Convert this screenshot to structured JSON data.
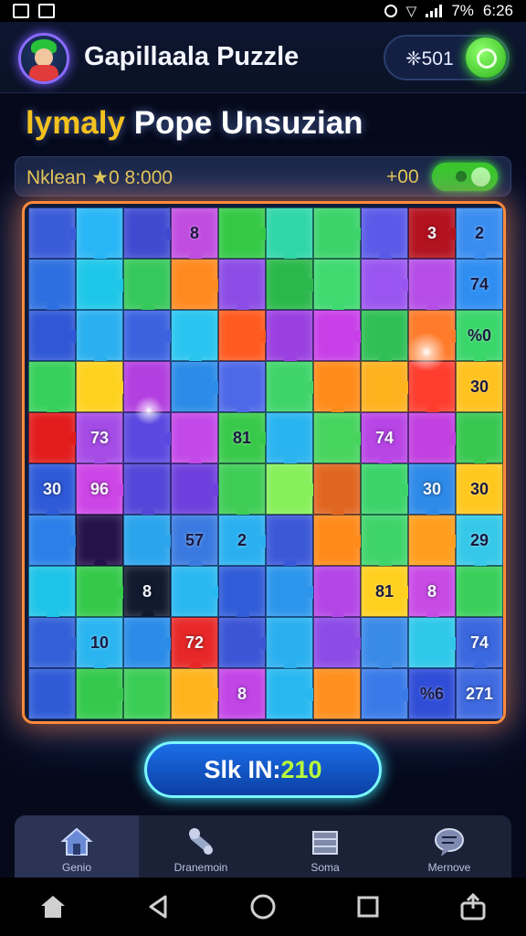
{
  "status_bar": {
    "battery": "7%",
    "time": "6:26"
  },
  "header": {
    "title": "Gapillaala Puzzle",
    "coins": "❈501"
  },
  "subtitle": {
    "part_a": "lymaly",
    "part_b": " Pope Unsuzian"
  },
  "info_bar": {
    "label": "Nklean ★0 8:000",
    "score": "+00"
  },
  "board": {
    "rows": [
      [
        {
          "c": "#3a5bd8"
        },
        {
          "c": "#29b6f6"
        },
        {
          "c": "#3f4ad0"
        },
        {
          "c": "#c04de0",
          "t": "8"
        },
        {
          "c": "#34c945"
        },
        {
          "c": "#2fd6a8"
        },
        {
          "c": "#3bd36a"
        },
        {
          "c": "#5a5ae8"
        },
        {
          "c": "#b3121f",
          "t": "3",
          "l": true
        },
        {
          "c": "#3a8df0",
          "t": "2"
        }
      ],
      [
        {
          "c": "#2d6fe0"
        },
        {
          "c": "#1ec7e8"
        },
        {
          "c": "#35c85a"
        },
        {
          "c": "#ff8a1f"
        },
        {
          "c": "#8c4ce6"
        },
        {
          "c": "#2ab84a"
        },
        {
          "c": "#3ed96f"
        },
        {
          "c": "#9a55f0"
        },
        {
          "c": "#b54de6"
        },
        {
          "c": "#2f8ef2",
          "t": "74"
        }
      ],
      [
        {
          "c": "#2f57d6"
        },
        {
          "c": "#2ab0f0"
        },
        {
          "c": "#3b63e0"
        },
        {
          "c": "#29c5f0"
        },
        {
          "c": "#ff5a1f"
        },
        {
          "c": "#9a3fe0"
        },
        {
          "c": "#c83fe8"
        },
        {
          "c": "#2fbf55"
        },
        {
          "c": "#ff7a2a"
        },
        {
          "c": "#39d66a",
          "t": "%0"
        }
      ],
      [
        {
          "c": "#36d05a"
        },
        {
          "c": "#ffd21e"
        },
        {
          "c": "#b23fe0"
        },
        {
          "c": "#2a8be8"
        },
        {
          "c": "#4d68e8"
        },
        {
          "c": "#3fd46a"
        },
        {
          "c": "#ff8c1a"
        },
        {
          "c": "#ffb11e"
        },
        {
          "c": "#ff3d2e"
        },
        {
          "c": "#ffc21e",
          "t": "30"
        }
      ],
      [
        {
          "c": "#e21b1b"
        },
        {
          "c": "#a64ce6",
          "t": "73",
          "l": true
        },
        {
          "c": "#5b48e0"
        },
        {
          "c": "#c348e8"
        },
        {
          "c": "#39c94a",
          "t": "81"
        },
        {
          "c": "#29b4f0"
        },
        {
          "c": "#47d45e"
        },
        {
          "c": "#b845e6",
          "t": "74",
          "l": true
        },
        {
          "c": "#c23fe0"
        },
        {
          "c": "#38c750"
        }
      ],
      [
        {
          "c": "#2e5ad8",
          "t": "30",
          "l": true
        },
        {
          "c": "#cc45e6",
          "t": "96",
          "l": true
        },
        {
          "c": "#5446d8"
        },
        {
          "c": "#6e3fdc"
        },
        {
          "c": "#3fcd55"
        },
        {
          "c": "#86f05a"
        },
        {
          "c": "#e0661f"
        },
        {
          "c": "#3bd36a"
        },
        {
          "c": "#2e8ae8",
          "t": "30",
          "l": true
        },
        {
          "c": "#ffc81e",
          "t": "30"
        }
      ],
      [
        {
          "c": "#2a80e8"
        },
        {
          "c": "#26124a"
        },
        {
          "c": "#2aa4ec"
        },
        {
          "c": "#3a7ae0",
          "t": "57"
        },
        {
          "c": "#2ab0f0",
          "t": "2"
        },
        {
          "c": "#3b58d8"
        },
        {
          "c": "#ff8a1a"
        },
        {
          "c": "#3fd46a"
        },
        {
          "c": "#ff9e1e"
        },
        {
          "c": "#35c8e8",
          "t": "29"
        }
      ],
      [
        {
          "c": "#1ec4e8"
        },
        {
          "c": "#35c94a"
        },
        {
          "c": "#111a2e",
          "t": "8",
          "l": true
        },
        {
          "c": "#2ab8f0"
        },
        {
          "c": "#2f5cd8"
        },
        {
          "c": "#2c96ec"
        },
        {
          "c": "#b345e6"
        },
        {
          "c": "#ffd01e",
          "t": "81"
        },
        {
          "c": "#c84be6",
          "t": "8",
          "l": true
        },
        {
          "c": "#39cf5a"
        }
      ],
      [
        {
          "c": "#3160d8"
        },
        {
          "c": "#2bb5f0",
          "t": "10"
        },
        {
          "c": "#2a8ce8"
        },
        {
          "c": "#e82828",
          "t": "72",
          "l": true
        },
        {
          "c": "#3b55d6"
        },
        {
          "c": "#2ab0ef"
        },
        {
          "c": "#8c4be6"
        },
        {
          "c": "#3a8ae8"
        },
        {
          "c": "#2fc8ea"
        },
        {
          "c": "#3a68df",
          "t": "74",
          "l": true
        }
      ],
      [
        {
          "c": "#2f5bd6"
        },
        {
          "c": "#34c94c"
        },
        {
          "c": "#3acd55"
        },
        {
          "c": "#ffb41e"
        },
        {
          "c": "#c245e6",
          "t": "8",
          "l": true
        },
        {
          "c": "#28b8f0"
        },
        {
          "c": "#ff8f1e"
        },
        {
          "c": "#3a7ae8"
        },
        {
          "c": "#2f4dd6",
          "t": "%6"
        },
        {
          "c": "#3f6ae0",
          "t": "271",
          "l": true
        }
      ]
    ]
  },
  "main_button": {
    "label": "Slk IN:",
    "number": "210"
  },
  "nav": [
    {
      "label": "Genio",
      "icon": "house-icon"
    },
    {
      "label": "Dranemoin",
      "icon": "tools-icon"
    },
    {
      "label": "Soma",
      "icon": "crate-icon"
    },
    {
      "label": "Mernove",
      "icon": "chat-icon"
    }
  ],
  "colors": {
    "accent": "#3ee8ff",
    "frame": "#ff8a3a",
    "score": "#f3d14b",
    "toggle": "#3ccb22"
  }
}
